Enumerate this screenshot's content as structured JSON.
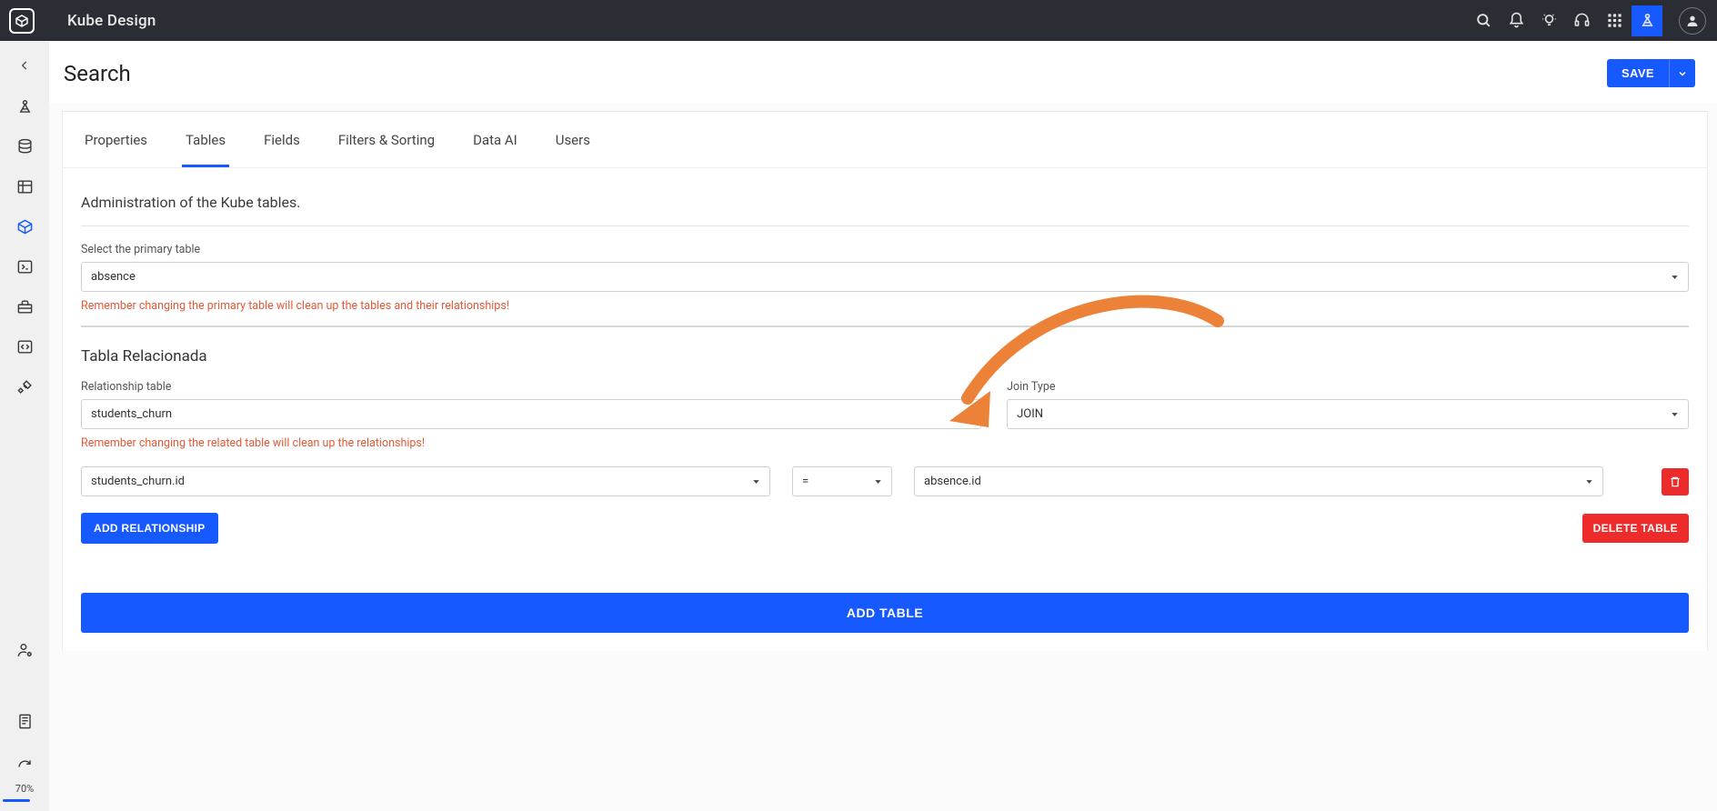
{
  "header": {
    "app_title": "Kube Design"
  },
  "page": {
    "title": "Search",
    "save_label": "SAVE"
  },
  "tabs": [
    {
      "label": "Properties",
      "active": false
    },
    {
      "label": "Tables",
      "active": true
    },
    {
      "label": "Fields",
      "active": false
    },
    {
      "label": "Filters & Sorting",
      "active": false
    },
    {
      "label": "Data AI",
      "active": false
    },
    {
      "label": "Users",
      "active": false
    }
  ],
  "tables_section": {
    "subtitle": "Administration of the Kube tables.",
    "primary_label": "Select the primary table",
    "primary_value": "absence",
    "primary_warning": "Remember changing the primary table will clean up the tables and their relationships!",
    "related_title": "Tabla Relacionada",
    "relationship_table_label": "Relationship table",
    "relationship_table_value": "students_churn",
    "join_type_label": "Join Type",
    "join_type_value": "JOIN",
    "related_warning": "Remember changing the related table will clean up the relationships!",
    "rel_left": "students_churn.id",
    "rel_op": "=",
    "rel_right": "absence.id",
    "add_relationship_label": "ADD RELATIONSHIP",
    "delete_table_label": "DELETE TABLE",
    "add_table_label": "ADD TABLE"
  },
  "sidebar": {
    "zoom": "70%"
  }
}
